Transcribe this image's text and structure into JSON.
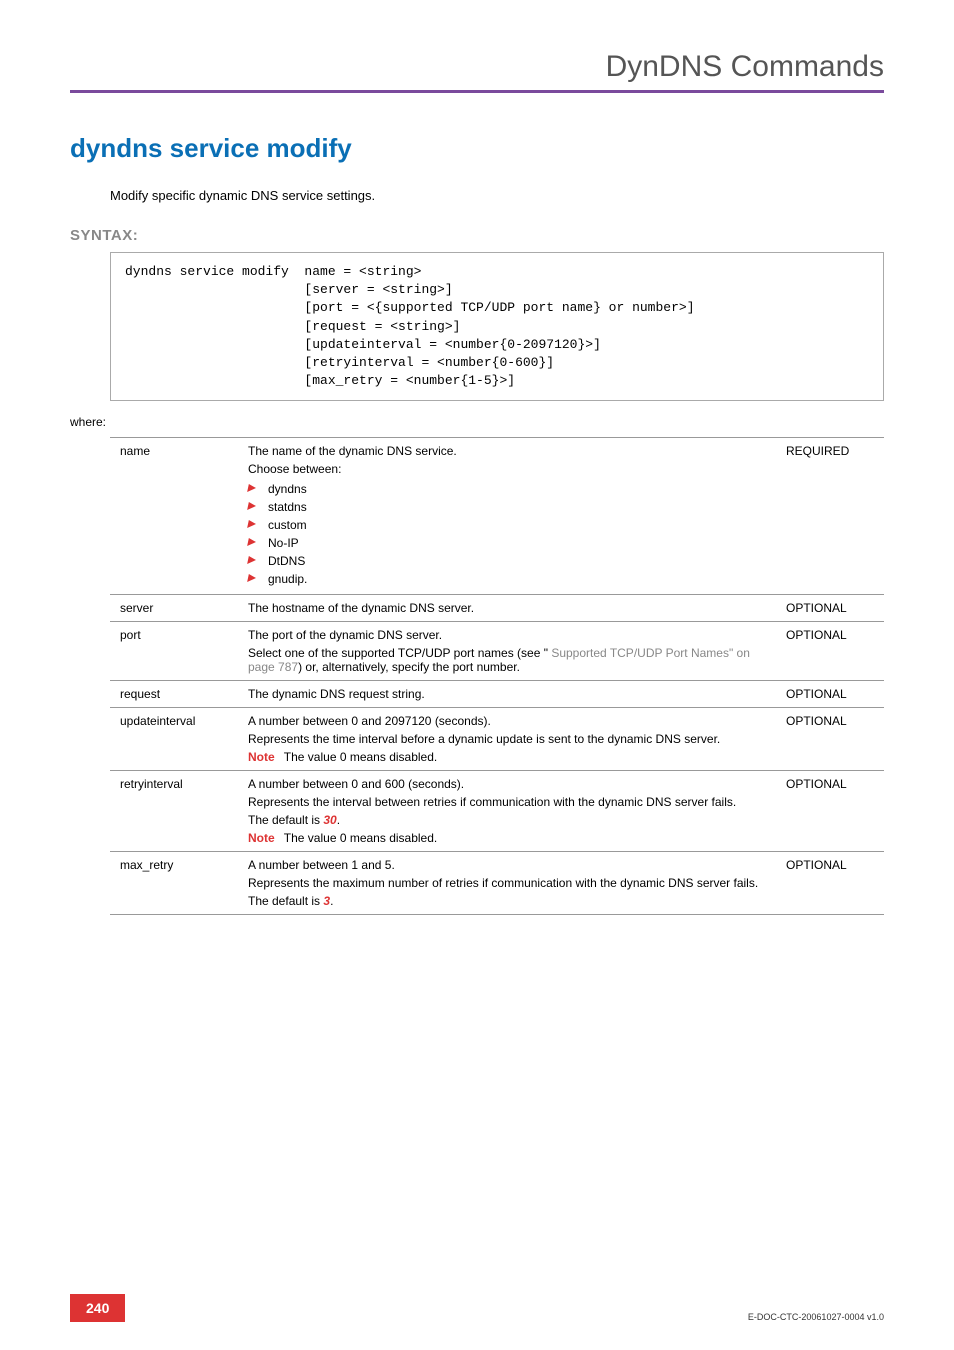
{
  "header": {
    "title": "DynDNS Commands"
  },
  "h1": "dyndns service modify",
  "intro": "Modify specific dynamic DNS service settings.",
  "syntax_label": "SYNTAX:",
  "syntax": "dyndns service modify  name = <string>\n                       [server = <string>]\n                       [port = <{supported TCP/UDP port name} or number>]\n                       [request = <string>]\n                       [updateinterval = <number{0-2097120}>]\n                       [retryinterval = <number{0-600}]\n                       [max_retry = <number{1-5}>]",
  "where": "where:",
  "required": "REQUIRED",
  "optional": "OPTIONAL",
  "note_label": "Note",
  "params": {
    "name": {
      "label": "name",
      "desc_lead": "The name of the dynamic DNS service.",
      "choose": "Choose between:",
      "options": [
        "dyndns",
        "statdns",
        "custom",
        "No-IP",
        "DtDNS",
        "gnudip."
      ]
    },
    "server": {
      "label": "server",
      "desc": "The hostname of the dynamic DNS server."
    },
    "port": {
      "label": "port",
      "desc1": "The port of the dynamic DNS server.",
      "desc2a": "Select one of the supported TCP/UDP port names (see \"",
      "desc2_link": " Supported TCP/UDP Port Names\" on page 787",
      "desc2b": ") or, alternatively, specify the port number."
    },
    "request": {
      "label": "request",
      "desc": "The dynamic DNS request string."
    },
    "updateinterval": {
      "label": "updateinterval",
      "desc1": "A number between 0 and 2097120 (seconds).",
      "desc2": "Represents the time interval before a dynamic update is sent to the dynamic DNS server.",
      "note": "The value 0 means disabled."
    },
    "retryinterval": {
      "label": "retryinterval",
      "desc1": "A number between 0 and 600 (seconds).",
      "desc2": "Represents the interval between retries if communication with the dynamic DNS server fails.",
      "default_prefix": "The default is ",
      "default_val": "30",
      "default_suffix": ".",
      "note": "The value 0 means disabled."
    },
    "max_retry": {
      "label": "max_retry",
      "desc1": "A number between 1 and 5.",
      "desc2": "Represents the maximum number of retries if communication with the dynamic DNS server fails.",
      "default_prefix": "The default is ",
      "default_val": "3",
      "default_suffix": "."
    }
  },
  "footer": {
    "page": "240",
    "docid": "E-DOC-CTC-20061027-0004 v1.0"
  }
}
